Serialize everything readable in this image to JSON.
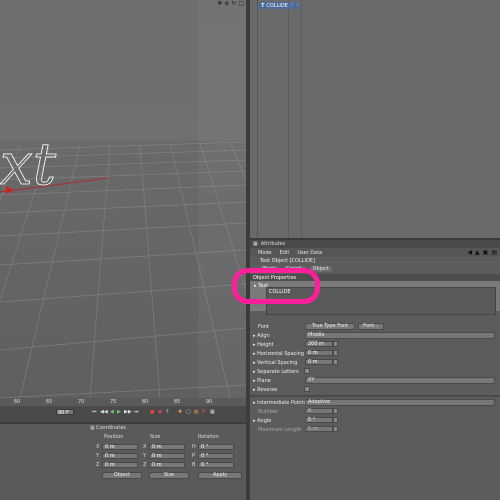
{
  "viewport": {
    "text_fragment": "xt",
    "top_icons": [
      "move-icon",
      "zoom-icon",
      "rotate-icon",
      "maximize-icon"
    ]
  },
  "object_manager": {
    "object_name": "COLLIDE",
    "status_icons": "✓ ✓"
  },
  "attributes": {
    "title": "Attributes",
    "menu": [
      "Mode",
      "Edit",
      "User Data"
    ],
    "object_title": "Text Object [COLLIDE]",
    "tabs": [
      "Basic",
      "Coord.",
      "Object"
    ],
    "group": "Object Properties",
    "text_label": "▸ Text",
    "text_value": "COLLIDE",
    "props": {
      "font_label": "Font",
      "font_value": "True Type Font",
      "font_button": "Font...",
      "align_label": "▸ Align",
      "align_value": "Middle",
      "height_label": "▸ Height",
      "height_value": "200 m",
      "hspacing_label": "▸ Horizontal Spacing",
      "hspacing_value": "0 m",
      "vspacing_label": "▸ Vertical Spacing",
      "vspacing_value": "0 m",
      "separate_label": "▸ Separate Letters",
      "plane_label": "▸ Plane",
      "plane_value": "XY",
      "reverse_label": "▸ Reverse",
      "interp_label": "▸ Intermediate Points",
      "interp_value": "Adaptive",
      "number_label": "Number",
      "number_value": "8",
      "angle_label": "▸ Angle",
      "angle_value": "5 °",
      "maxlen_label": "Maximum Length",
      "maxlen_value": "5 m"
    }
  },
  "timeline": {
    "ticks": [
      "60",
      "65",
      "70",
      "75",
      "80",
      "85",
      "90"
    ],
    "frame_field": "90 F"
  },
  "coordinates": {
    "title": "Coordinates",
    "headers": [
      "Position",
      "Size",
      "Rotation"
    ],
    "rows": [
      {
        "axis": "X",
        "pos": "0 m",
        "size_axis": "X",
        "size": "0 m",
        "rot_axis": "H",
        "rot": "0 °"
      },
      {
        "axis": "Y",
        "pos": "0 m",
        "size_axis": "Y",
        "size": "0 m",
        "rot_axis": "P",
        "rot": "0 °"
      },
      {
        "axis": "Z",
        "pos": "0 m",
        "size_axis": "Z",
        "size": "0 m",
        "rot_axis": "B",
        "rot": "0 °"
      }
    ],
    "mode1": "Object",
    "mode2": "Size",
    "apply": "Apply"
  },
  "colors": {
    "highlight": "#ff1f9b",
    "selection": "#4d6a9a",
    "spline": "#ffffff"
  }
}
